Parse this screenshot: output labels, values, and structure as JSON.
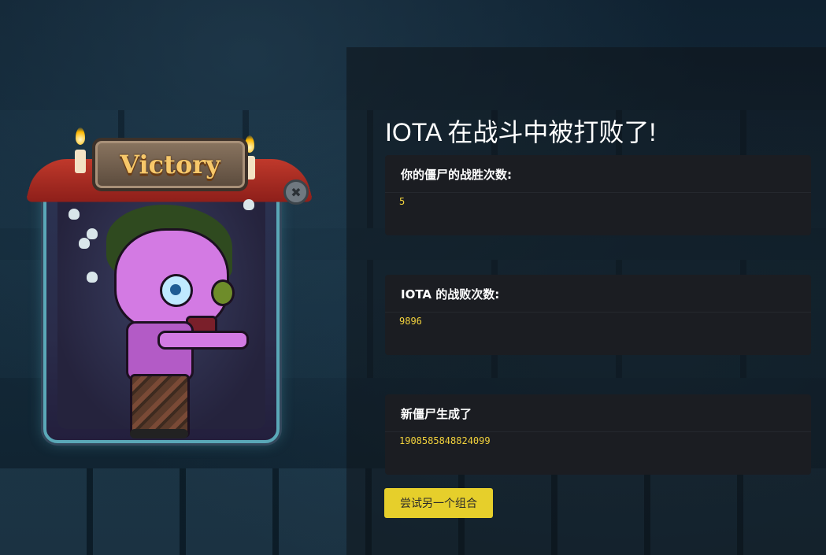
{
  "colors": {
    "accent": "#e6cf2b",
    "value_text": "#f2d23c",
    "box_bg": "#1b1d22",
    "page_bg": "#0d1b26"
  },
  "card": {
    "banner_text": "Victory",
    "icons": [
      "candle-icon",
      "skull-icon",
      "close-icon"
    ]
  },
  "result": {
    "title": "IOTA 在战斗中被打败了!"
  },
  "stats": [
    {
      "label": "你的僵尸的战胜次数:",
      "value": "5"
    },
    {
      "label": "IOTA 的战败次数:",
      "value": "9896"
    },
    {
      "label": "新僵尸生成了",
      "value": "1908585848824099"
    }
  ],
  "actions": {
    "retry_label": "尝试另一个组合"
  }
}
